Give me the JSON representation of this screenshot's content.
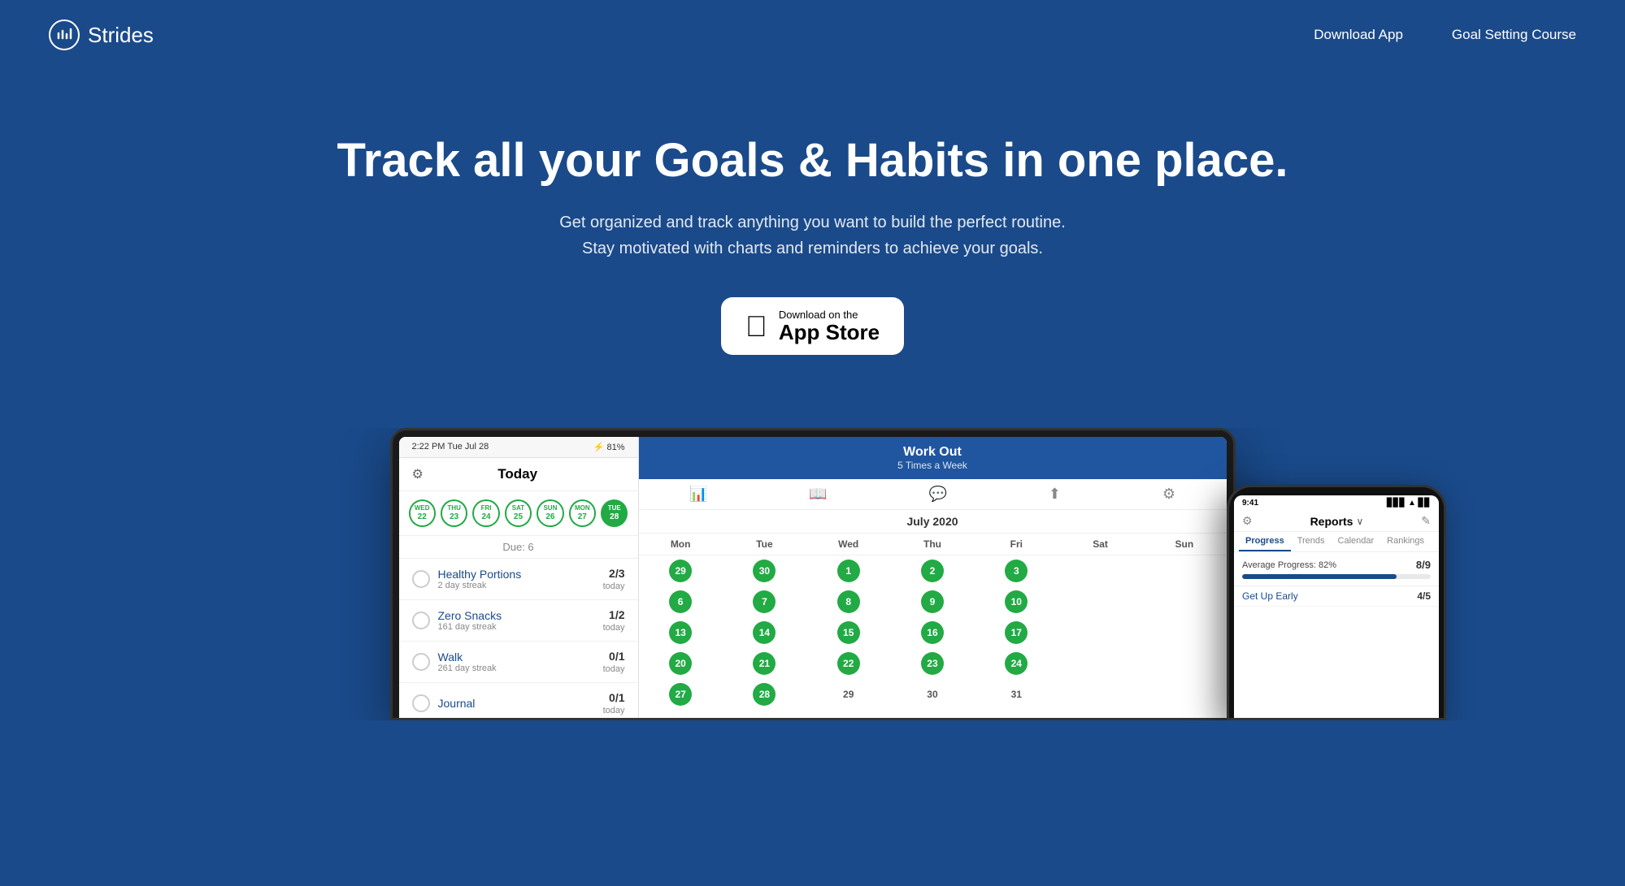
{
  "header": {
    "logo_text": "Strides",
    "nav": {
      "download": "Download App",
      "course": "Goal Setting Course"
    }
  },
  "hero": {
    "title": "Track all your Goals & Habits in one place.",
    "subtitle_line1": "Get organized and track anything you want to build the perfect routine.",
    "subtitle_line2": "Stay motivated with charts and reminders to achieve your goals.",
    "cta_top": "Download on the",
    "cta_bottom": "App Store"
  },
  "tablet": {
    "status_time": "2:22 PM  Tue Jul 28",
    "status_right": "⚡ 81%",
    "left_panel": {
      "title": "Today",
      "days": [
        {
          "label": "WED",
          "num": "22"
        },
        {
          "label": "THU",
          "num": "23"
        },
        {
          "label": "FRI",
          "num": "24"
        },
        {
          "label": "SAT",
          "num": "25"
        },
        {
          "label": "SUN",
          "num": "26"
        },
        {
          "label": "MON",
          "num": "27"
        },
        {
          "label": "TUE",
          "num": "28",
          "active": true
        }
      ],
      "due_label": "Due: 6",
      "habits": [
        {
          "name": "Healthy Portions",
          "streak": "2 day streak",
          "fraction": "2/3",
          "today": "today"
        },
        {
          "name": "Zero Snacks",
          "streak": "161 day streak",
          "fraction": "1/2",
          "today": "today"
        },
        {
          "name": "Walk",
          "streak": "261 day streak",
          "fraction": "0/1",
          "today": "today"
        },
        {
          "name": "Journal",
          "streak": "",
          "fraction": "0/1",
          "today": "today"
        }
      ]
    },
    "right_panel": {
      "workout_title": "Work Out",
      "workout_subtitle": "5 Times a Week",
      "calendar_month": "July 2020",
      "day_headers": [
        "Mon",
        "Tue",
        "Wed",
        "Thu",
        "Fri",
        "Sat",
        "Sun"
      ],
      "weeks": [
        [
          {
            "n": "29",
            "filled": true
          },
          {
            "n": "30",
            "filled": true
          },
          {
            "n": "1",
            "filled": true
          },
          {
            "n": "2",
            "filled": true
          },
          {
            "n": "3",
            "filled": true
          },
          {
            "n": "",
            "filled": false
          },
          {
            "n": "",
            "filled": false
          }
        ],
        [
          {
            "n": "6",
            "filled": true
          },
          {
            "n": "7",
            "filled": true
          },
          {
            "n": "8",
            "filled": true
          },
          {
            "n": "9",
            "filled": true
          },
          {
            "n": "10",
            "filled": true
          },
          {
            "n": "",
            "filled": false
          },
          {
            "n": "",
            "filled": false
          }
        ],
        [
          {
            "n": "13",
            "filled": true
          },
          {
            "n": "14",
            "filled": true
          },
          {
            "n": "15",
            "filled": true
          },
          {
            "n": "16",
            "filled": true
          },
          {
            "n": "17",
            "filled": true
          },
          {
            "n": "",
            "filled": false
          },
          {
            "n": "",
            "filled": false
          }
        ],
        [
          {
            "n": "20",
            "filled": true
          },
          {
            "n": "21",
            "filled": true
          },
          {
            "n": "22",
            "filled": true
          },
          {
            "n": "23",
            "filled": true
          },
          {
            "n": "24",
            "filled": true
          },
          {
            "n": "",
            "filled": false
          },
          {
            "n": "",
            "filled": false
          }
        ],
        [
          {
            "n": "27",
            "filled": true
          },
          {
            "n": "28",
            "filled": true
          },
          {
            "n": "29",
            "filled": false
          },
          {
            "n": "30",
            "filled": false
          },
          {
            "n": "31",
            "filled": false
          },
          {
            "n": "",
            "filled": false
          },
          {
            "n": "",
            "filled": false
          }
        ]
      ]
    }
  },
  "phone": {
    "status_time": "9:41",
    "header_title": "Reports",
    "header_chevron": "∨",
    "tabs": [
      "Progress",
      "Trends",
      "Calendar",
      "Rankings"
    ],
    "active_tab": "Progress",
    "avg_label": "Average Progress: 82%",
    "avg_score": "8/9",
    "progress_fill": 82,
    "habits": [
      {
        "name": "Get Up Early",
        "score": "4/5"
      }
    ]
  },
  "colors": {
    "bg": "#1a4a8a",
    "green": "#22aa44",
    "dark_blue": "#2055a0"
  }
}
